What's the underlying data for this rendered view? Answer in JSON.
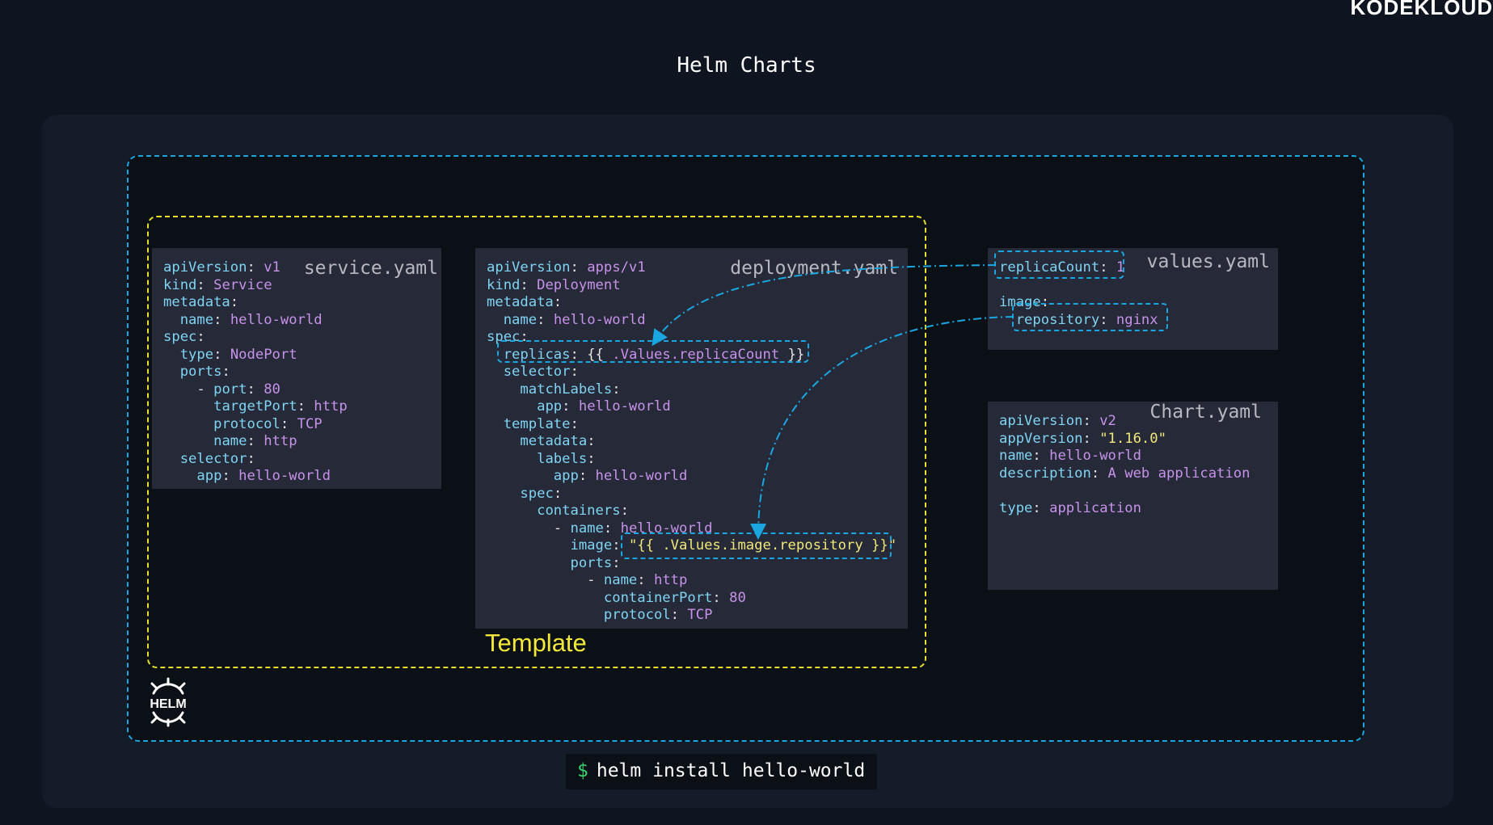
{
  "brand": "KODEKLOUD",
  "title": "Helm Charts",
  "template_label": "Template",
  "helm_logo_text": "HELM",
  "command": {
    "prompt": "$",
    "text": "helm install hello-world"
  },
  "files": [
    {
      "name": "service.yaml",
      "lines": [
        [
          [
            "k",
            "apiVersion"
          ],
          [
            "p",
            ": "
          ],
          [
            "v",
            "v1"
          ]
        ],
        [
          [
            "k",
            "kind"
          ],
          [
            "p",
            ": "
          ],
          [
            "v",
            "Service"
          ]
        ],
        [
          [
            "k",
            "metadata"
          ],
          [
            "p",
            ":"
          ]
        ],
        [
          [
            "p",
            "  "
          ],
          [
            "k",
            "name"
          ],
          [
            "p",
            ": "
          ],
          [
            "v",
            "hello-world"
          ]
        ],
        [
          [
            "k",
            "spec"
          ],
          [
            "p",
            ":"
          ]
        ],
        [
          [
            "p",
            "  "
          ],
          [
            "k",
            "type"
          ],
          [
            "p",
            ": "
          ],
          [
            "v",
            "NodePort"
          ]
        ],
        [
          [
            "p",
            "  "
          ],
          [
            "k",
            "ports"
          ],
          [
            "p",
            ":"
          ]
        ],
        [
          [
            "p",
            "    - "
          ],
          [
            "k",
            "port"
          ],
          [
            "p",
            ": "
          ],
          [
            "v",
            "80"
          ]
        ],
        [
          [
            "p",
            "      "
          ],
          [
            "k",
            "targetPort"
          ],
          [
            "p",
            ": "
          ],
          [
            "v",
            "http"
          ]
        ],
        [
          [
            "p",
            "      "
          ],
          [
            "k",
            "protocol"
          ],
          [
            "p",
            ": "
          ],
          [
            "v",
            "TCP"
          ]
        ],
        [
          [
            "p",
            "      "
          ],
          [
            "k",
            "name"
          ],
          [
            "p",
            ": "
          ],
          [
            "v",
            "http"
          ]
        ],
        [
          [
            "p",
            "  "
          ],
          [
            "k",
            "selector"
          ],
          [
            "p",
            ":"
          ]
        ],
        [
          [
            "p",
            "    "
          ],
          [
            "k",
            "app"
          ],
          [
            "p",
            ": "
          ],
          [
            "v",
            "hello-world"
          ]
        ]
      ]
    },
    {
      "name": "deployment.yaml",
      "lines": [
        [
          [
            "k",
            "apiVersion"
          ],
          [
            "p",
            ": "
          ],
          [
            "v",
            "apps/v1"
          ]
        ],
        [
          [
            "k",
            "kind"
          ],
          [
            "p",
            ": "
          ],
          [
            "v",
            "Deployment"
          ]
        ],
        [
          [
            "k",
            "metadata"
          ],
          [
            "p",
            ":"
          ]
        ],
        [
          [
            "p",
            "  "
          ],
          [
            "k",
            "name"
          ],
          [
            "p",
            ": "
          ],
          [
            "v",
            "hello-world"
          ]
        ],
        [
          [
            "k",
            "spec"
          ],
          [
            "p",
            ":"
          ]
        ],
        [
          [
            "p",
            "  "
          ],
          [
            "k",
            "replicas"
          ],
          [
            "p",
            ": "
          ],
          [
            "p",
            "{{ "
          ],
          [
            "v",
            ".Values.replicaCount"
          ],
          [
            "p",
            " }}"
          ]
        ],
        [
          [
            "p",
            "  "
          ],
          [
            "k",
            "selector"
          ],
          [
            "p",
            ":"
          ]
        ],
        [
          [
            "p",
            "    "
          ],
          [
            "k",
            "matchLabels"
          ],
          [
            "p",
            ":"
          ]
        ],
        [
          [
            "p",
            "      "
          ],
          [
            "k",
            "app"
          ],
          [
            "p",
            ": "
          ],
          [
            "v",
            "hello-world"
          ]
        ],
        [
          [
            "p",
            "  "
          ],
          [
            "k",
            "template"
          ],
          [
            "p",
            ":"
          ]
        ],
        [
          [
            "p",
            "    "
          ],
          [
            "k",
            "metadata"
          ],
          [
            "p",
            ":"
          ]
        ],
        [
          [
            "p",
            "      "
          ],
          [
            "k",
            "labels"
          ],
          [
            "p",
            ":"
          ]
        ],
        [
          [
            "p",
            "        "
          ],
          [
            "k",
            "app"
          ],
          [
            "p",
            ": "
          ],
          [
            "v",
            "hello-world"
          ]
        ],
        [
          [
            "p",
            "    "
          ],
          [
            "k",
            "spec"
          ],
          [
            "p",
            ":"
          ]
        ],
        [
          [
            "p",
            "      "
          ],
          [
            "k",
            "containers"
          ],
          [
            "p",
            ":"
          ]
        ],
        [
          [
            "p",
            "        - "
          ],
          [
            "k",
            "name"
          ],
          [
            "p",
            ": "
          ],
          [
            "v",
            "hello-world"
          ]
        ],
        [
          [
            "p",
            "          "
          ],
          [
            "k",
            "image"
          ],
          [
            "p",
            ": "
          ],
          [
            "s",
            "\"{{ .Values.image.repository }}\""
          ]
        ],
        [
          [
            "p",
            "          "
          ],
          [
            "k",
            "ports"
          ],
          [
            "p",
            ":"
          ]
        ],
        [
          [
            "p",
            "            - "
          ],
          [
            "k",
            "name"
          ],
          [
            "p",
            ": "
          ],
          [
            "v",
            "http"
          ]
        ],
        [
          [
            "p",
            "              "
          ],
          [
            "k",
            "containerPort"
          ],
          [
            "p",
            ": "
          ],
          [
            "v",
            "80"
          ]
        ],
        [
          [
            "p",
            "              "
          ],
          [
            "k",
            "protocol"
          ],
          [
            "p",
            ": "
          ],
          [
            "v",
            "TCP"
          ]
        ]
      ]
    },
    {
      "name": "values.yaml",
      "lines": [
        [
          [
            "k",
            "replicaCount"
          ],
          [
            "p",
            ": "
          ],
          [
            "v",
            "1"
          ]
        ],
        [
          [
            "p",
            ""
          ]
        ],
        [
          [
            "k",
            "image"
          ],
          [
            "p",
            ":"
          ]
        ],
        [
          [
            "p",
            "  "
          ],
          [
            "k",
            "repository"
          ],
          [
            "p",
            ": "
          ],
          [
            "v",
            "nginx"
          ]
        ]
      ]
    },
    {
      "name": "Chart.yaml",
      "lines": [
        [
          [
            "k",
            "apiVersion"
          ],
          [
            "p",
            ": "
          ],
          [
            "v",
            "v2"
          ]
        ],
        [
          [
            "k",
            "appVersion"
          ],
          [
            "p",
            ": "
          ],
          [
            "s",
            "\"1.16.0\""
          ]
        ],
        [
          [
            "k",
            "name"
          ],
          [
            "p",
            ": "
          ],
          [
            "v",
            "hello-world"
          ]
        ],
        [
          [
            "k",
            "description"
          ],
          [
            "p",
            ": "
          ],
          [
            "v",
            "A web application"
          ]
        ],
        [
          [
            "p",
            ""
          ]
        ],
        [
          [
            "k",
            "type"
          ],
          [
            "p",
            ": "
          ],
          [
            "v",
            "application"
          ]
        ]
      ]
    }
  ]
}
